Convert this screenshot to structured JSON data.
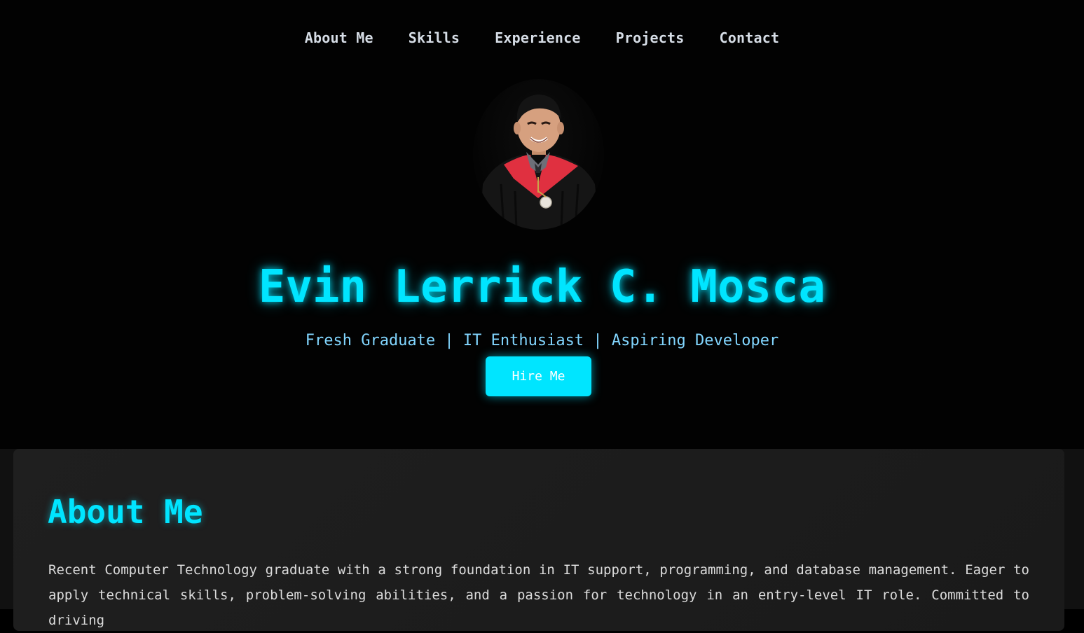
{
  "nav": {
    "items": [
      {
        "label": "About Me"
      },
      {
        "label": "Skills"
      },
      {
        "label": "Experience"
      },
      {
        "label": "Projects"
      },
      {
        "label": "Contact"
      }
    ]
  },
  "hero": {
    "name": "Evin Lerrick C. Mosca",
    "tagline": "Fresh Graduate | IT Enthusiast | Aspiring Developer",
    "cta_label": "Hire Me",
    "avatar_icon": "profile-photo"
  },
  "about": {
    "title": "About Me",
    "text": "Recent Computer Technology graduate with a strong foundation in IT support, programming, and database management. Eager to apply technical skills, problem-solving abilities, and a passion for technology in an entry-level IT role. Committed to driving"
  },
  "colors": {
    "accent": "#00e5ff",
    "tagline": "#82d6ff",
    "background": "#000000",
    "card": "#1e1e1e",
    "nav_text": "#d6dde6"
  }
}
